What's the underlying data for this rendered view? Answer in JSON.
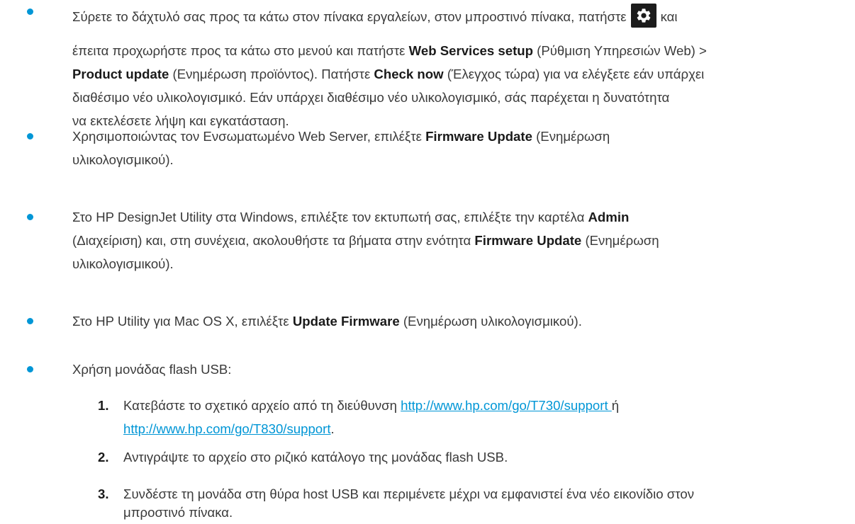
{
  "bullets": [
    {
      "line1_pre": "Σύρετε το δάχτυλό σας προς τα κάτω στον πίνακα εργαλείων, στον μπροστινό πίνακα, πατήστε",
      "line1_post": "και",
      "line2_pre": "έπειτα προχωρήστε προς τα κάτω στο μενού και πατήστε ",
      "line2_bold": "Web Services setup",
      "line2_post": " (Ρύθμιση Υπηρεσιών Web) >",
      "line3_bold1": "Product update",
      "line3_mid": " (Ενημέρωση προϊόντος). Πατήστε ",
      "line3_bold2": "Check now",
      "line3_post": " (Έλεγχος τώρα) για να ελέγξετε εάν υπάρχει",
      "line4": "διαθέσιμο νέο υλικολογισμικό. Εάν υπάρχει διαθέσιμο νέο υλικολογισμικό, σάς παρέχεται η δυνατότητα",
      "line5": "να εκτελέσετε λήψη και εγκατάσταση."
    },
    {
      "line1_pre": "Χρησιμοποιώντας τον Ενσωματωμένο Web Server, επιλέξτε ",
      "line1_bold": "Firmware Update",
      "line1_post": " (Ενημέρωση",
      "line2": "υλικολογισμικού)."
    },
    {
      "line1_pre": "Στο HP DesignJet Utility στα Windows, επιλέξτε τον εκτυπωτή σας, επιλέξτε την καρτέλα ",
      "line1_bold": "Admin",
      "line2_pre": "(Διαχείριση) και, στη συνέχεια, ακολουθήστε τα βήματα στην ενότητα ",
      "line2_bold": "Firmware Update",
      "line2_post": " (Ενημέρωση",
      "line3": "υλικολογισμικού)."
    },
    {
      "line1_pre": "Στο HP Utility για Mac OS X, επιλέξτε ",
      "line1_bold": "Update Firmware",
      "line1_post": " (Ενημέρωση υλικολογισμικού)."
    },
    {
      "line1": "Χρήση μονάδας flash USB:"
    }
  ],
  "steps": [
    {
      "num": "1.",
      "line1_pre": "Κατεβάστε το σχετικό αρχείο από τη διεύθυνση ",
      "link1": "http://www.hp.com/go/T730/support ",
      "line1_post": "ή",
      "link2": "http://www.hp.com/go/T830/support",
      "line2_post": "."
    },
    {
      "num": "2.",
      "line1": "Αντιγράψτε το αρχείο στο ριζικό κατάλογο της μονάδας flash USB."
    },
    {
      "num": "3.",
      "line1": "Συνδέστε τη μονάδα στη θύρα host USB και περιμένετε μέχρι να εμφανιστεί ένα νέο εικονίδιο στον",
      "line2": "μπροστινό πίνακα."
    }
  ],
  "icons": {
    "settings": "gear-icon"
  },
  "colors": {
    "bullet": "#0096d6",
    "link": "#0096d6",
    "icon_bg": "#1c1c1c"
  }
}
